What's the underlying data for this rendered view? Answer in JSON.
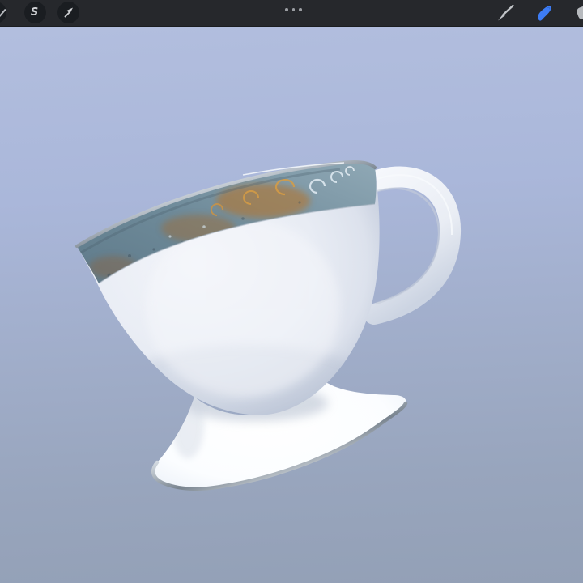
{
  "toolbar": {
    "left_tools": [
      {
        "id": "adjustments",
        "icon": "magic-wand-icon",
        "partial": true
      },
      {
        "id": "selection",
        "icon": "selection-s-icon",
        "glyph": "S"
      },
      {
        "id": "transform",
        "icon": "transform-arrow-icon"
      }
    ],
    "center": {
      "icon": "ellipsis-drag-handle-icon"
    },
    "right_tools": [
      {
        "id": "paint",
        "icon": "paintbrush-icon",
        "active": false
      },
      {
        "id": "smudge",
        "icon": "smudge-finger-icon",
        "active": true
      },
      {
        "id": "erase",
        "icon": "eraser-icon",
        "partial": true,
        "active": false
      }
    ]
  },
  "canvas": {
    "content": "3D-rendered white porcelain footed teacup, tilted, with ornate blue-gray and gold decorated rim band, platinum trim on rim, handle and pedestal foot, floating on a blue-gray gradient background"
  },
  "colors": {
    "toolbar_bg": "#26282c",
    "tool_circle_bg": "#1a1d21",
    "icon_gray": "#c6c8cb",
    "active_tool_blue": "#3d7cf4",
    "canvas_top": "#b2bede",
    "canvas_bottom": "#93a0b6",
    "porcelain_white": "#eef1f8",
    "band_blue_gray": "#74909f",
    "band_gold": "#bf8038",
    "platinum": "#d7dee6",
    "foot_white": "#fdfeff"
  }
}
